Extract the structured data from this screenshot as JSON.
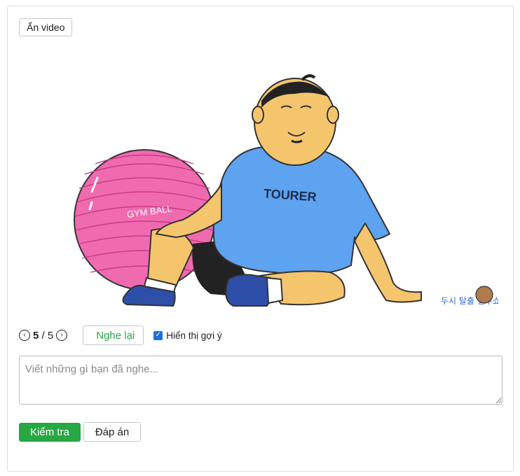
{
  "toolbar": {
    "hide_video_label": "Ẩn video"
  },
  "video": {
    "ball_text": "GYM BALL",
    "shirt_text": "TOURER",
    "watermark_text": "두시 탈출 컬투쇼"
  },
  "navigation": {
    "current": "5",
    "separator": "/",
    "total": "5",
    "prev_icon": "chevron-left-circle",
    "next_icon": "chevron-right-circle"
  },
  "replay": {
    "label": "Nghe lại",
    "color": "#28a745"
  },
  "hint": {
    "label": "Hiển thị gợi ý",
    "checked": true,
    "checkbox_color": "#1e6fd9"
  },
  "answer": {
    "placeholder": "Viết những gì bạn đã nghe...",
    "value": ""
  },
  "actions": {
    "check_label": "Kiểm tra",
    "check_color": "#28a745",
    "answer_label": "Đáp án"
  }
}
